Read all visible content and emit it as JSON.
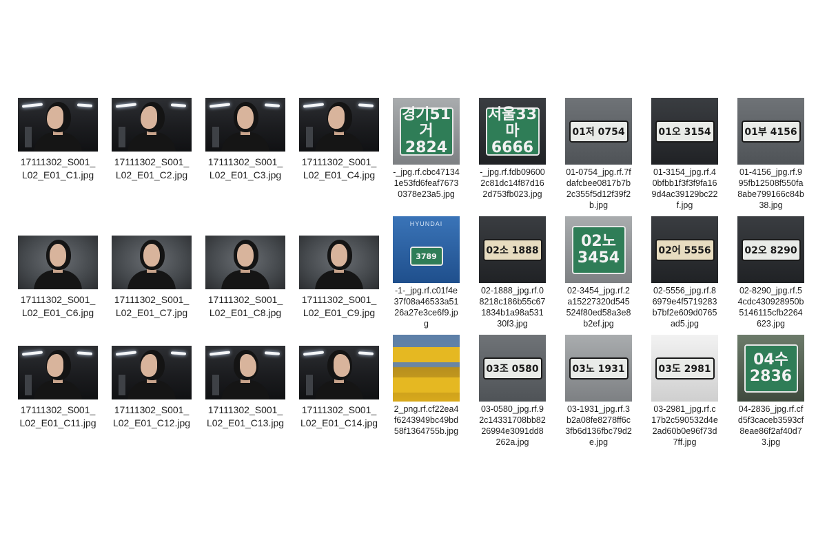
{
  "faces": [
    {
      "file": "17111302_S001_L02_E01_C1.jpg",
      "tone": "dark",
      "pose": "left"
    },
    {
      "file": "17111302_S001_L02_E01_C2.jpg",
      "tone": "dark",
      "pose": "left"
    },
    {
      "file": "17111302_S001_L02_E01_C3.jpg",
      "tone": "dark",
      "pose": "front"
    },
    {
      "file": "17111302_S001_L02_E01_C4.jpg",
      "tone": "dark",
      "pose": "left"
    },
    {
      "file": "17111302_S001_L02_E01_C6.jpg",
      "tone": "gray",
      "pose": "front"
    },
    {
      "file": "17111302_S001_L02_E01_C7.jpg",
      "tone": "gray",
      "pose": "front"
    },
    {
      "file": "17111302_S001_L02_E01_C8.jpg",
      "tone": "gray",
      "pose": "front"
    },
    {
      "file": "17111302_S001_L02_E01_C9.jpg",
      "tone": "gray",
      "pose": "front"
    },
    {
      "file": "17111302_S001_L02_E01_C11.jpg",
      "tone": "dark",
      "pose": "left"
    },
    {
      "file": "17111302_S001_L02_E01_C12.jpg",
      "tone": "dark",
      "pose": "left"
    },
    {
      "file": "17111302_S001_L02_E01_C13.jpg",
      "tone": "dark",
      "pose": "right"
    },
    {
      "file": "17111302_S001_L02_E01_C14.jpg",
      "tone": "dark",
      "pose": "right"
    }
  ],
  "plates": [
    {
      "file": "-_jpg.rf.cbc471341e53fd6feaf76730378e23a5.jpg",
      "plate": "경기51\n거2824",
      "style": "green",
      "bg": "car-silver"
    },
    {
      "file": "-_jpg.rf.fdb096002c81dc14f87d162d753fb023.jpg",
      "plate": "서울33\n마6666",
      "style": "green",
      "bg": "car-dark"
    },
    {
      "file": "01-0754_jpg.rf.7fdafcbee0817b7b2c355f5d12f39f2b.jpg",
      "plate": "01저 0754",
      "style": "white",
      "bg": "car-gray"
    },
    {
      "file": "01-3154_jpg.rf.40bfbb1f3f3f9fa169d4ac39129bc22f.jpg",
      "plate": "01오 3154",
      "style": "white",
      "bg": "car-dark"
    },
    {
      "file": "01-4156_jpg.rf.995fb12508f550fa8abe799166c84b38.jpg",
      "plate": "01부 4156",
      "style": "white",
      "bg": "car-gray"
    },
    {
      "file": "-1-_jpg.rf.c01f4e37f08a46533a5126a27e3ce6f9.jpg",
      "plate": "3789",
      "style": "green",
      "bg": "car-blue",
      "caption": "HYUNDAI"
    },
    {
      "file": "02-1888_jpg.rf.08218c186b55c671834b1a98a53130f3.jpg",
      "plate": "02소 1888",
      "style": "cream",
      "bg": "car-dark"
    },
    {
      "file": "02-3454_jpg.rf.2a15227320d545524f80ed58a3e8b2ef.jpg",
      "plate": "02노\n3454",
      "style": "green",
      "bg": "car-silver"
    },
    {
      "file": "02-5556_jpg.rf.86979e4f5719283b7bf2e609d0765ad5.jpg",
      "plate": "02어 5556",
      "style": "cream",
      "bg": "car-dark"
    },
    {
      "file": "02-8290_jpg.rf.54cdc430928950b5146115cfb2264623.jpg",
      "plate": "02오 8290",
      "style": "white",
      "bg": "car-dark"
    },
    {
      "file": "2_png.rf.cf22ea4f6243949bc49bd58f1364755b.jpg",
      "plate": "",
      "style": "none",
      "bg": "car-yellow"
    },
    {
      "file": "03-0580_jpg.rf.92c14331708bb8226994e3091dd8262a.jpg",
      "plate": "03조 0580",
      "style": "white",
      "bg": "car-gray"
    },
    {
      "file": "03-1931_jpg.rf.3b2a08fe8278ff6c3fb6d136fbc79d2e.jpg",
      "plate": "03노 1931",
      "style": "white",
      "bg": "car-silver"
    },
    {
      "file": "03-2981_jpg.rf.c17b2c590532d4e2ad60b0e96f73d7ff.jpg",
      "plate": "03도 2981",
      "style": "white",
      "bg": "car-white"
    },
    {
      "file": "04-2836_jpg.rf.cfd5f3caceb3593cf8eae86f2af40d73.jpg",
      "plate": "04수\n2836",
      "style": "green",
      "bg": "car-green"
    }
  ]
}
